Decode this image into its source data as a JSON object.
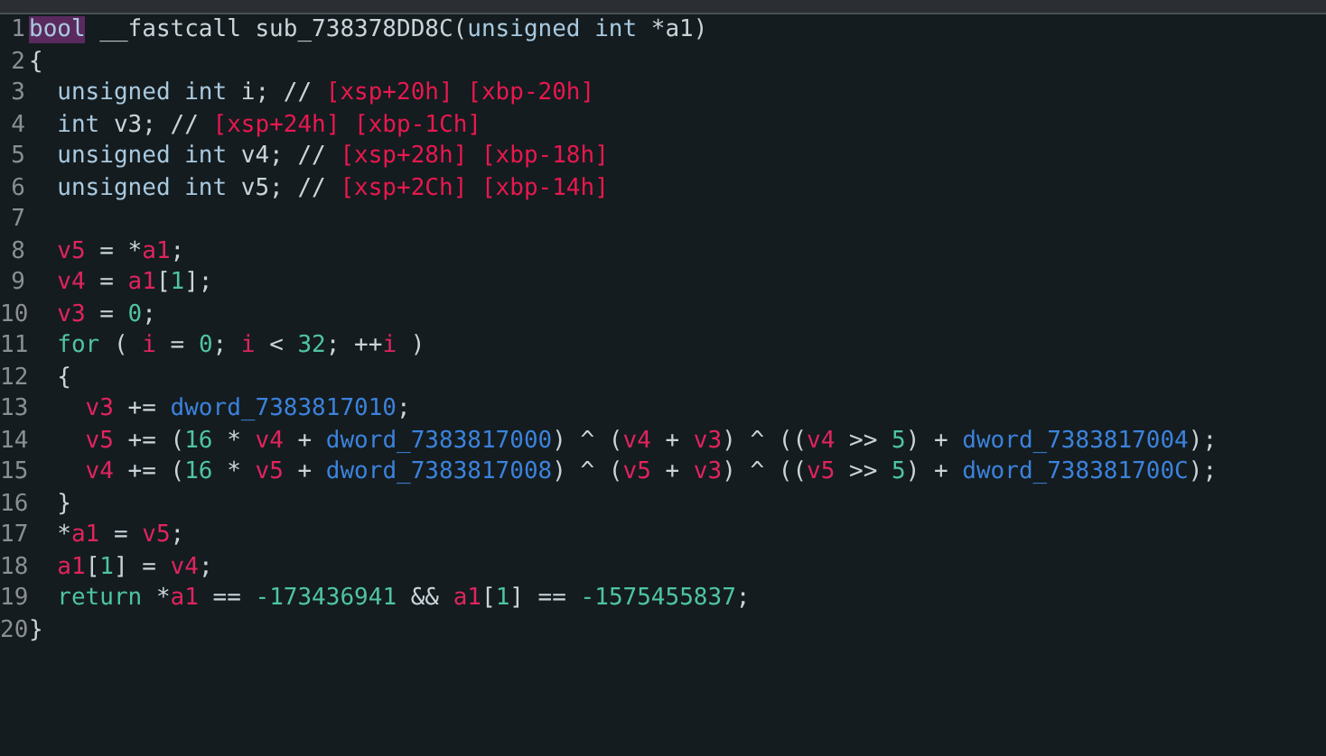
{
  "code_lines": [
    {
      "number": "1",
      "tokens": [
        {
          "text": "bool",
          "kind": "highlight"
        },
        {
          "text": " __fastcall sub_738378DD8C(",
          "kind": "plain"
        },
        {
          "text": "unsigned int",
          "kind": "type"
        },
        {
          "text": " *a1)",
          "kind": "plain"
        }
      ]
    },
    {
      "number": "2",
      "tokens": [
        {
          "text": "{",
          "kind": "plain"
        }
      ]
    },
    {
      "number": "3",
      "tokens": [
        {
          "text": "  unsigned int",
          "kind": "type"
        },
        {
          "text": " i; // ",
          "kind": "plain"
        },
        {
          "text": "[xsp+20h] [xbp-20h]",
          "kind": "comment"
        }
      ]
    },
    {
      "number": "4",
      "tokens": [
        {
          "text": "  int",
          "kind": "type"
        },
        {
          "text": " v3; // ",
          "kind": "plain"
        },
        {
          "text": "[xsp+24h] [xbp-1Ch]",
          "kind": "comment"
        }
      ]
    },
    {
      "number": "5",
      "tokens": [
        {
          "text": "  unsigned int",
          "kind": "type"
        },
        {
          "text": " v4; // ",
          "kind": "plain"
        },
        {
          "text": "[xsp+28h] [xbp-18h]",
          "kind": "comment"
        }
      ]
    },
    {
      "number": "6",
      "tokens": [
        {
          "text": "  unsigned int",
          "kind": "type"
        },
        {
          "text": " v5; // ",
          "kind": "plain"
        },
        {
          "text": "[xsp+2Ch] [xbp-14h]",
          "kind": "comment"
        }
      ]
    },
    {
      "number": "7"
    },
    {
      "number": "8",
      "tokens": [
        {
          "text": "  v5",
          "kind": "var"
        },
        {
          "text": " = *",
          "kind": "plain"
        },
        {
          "text": "a1",
          "kind": "var"
        },
        {
          "text": ";",
          "kind": "plain"
        }
      ]
    },
    {
      "number": "9",
      "tokens": [
        {
          "text": "  v4",
          "kind": "var"
        },
        {
          "text": " = ",
          "kind": "plain"
        },
        {
          "text": "a1",
          "kind": "var"
        },
        {
          "text": "[",
          "kind": "plain"
        },
        {
          "text": "1",
          "kind": "number"
        },
        {
          "text": "];",
          "kind": "plain"
        }
      ]
    },
    {
      "number": "10",
      "tokens": [
        {
          "text": "  v3",
          "kind": "var"
        },
        {
          "text": " = ",
          "kind": "plain"
        },
        {
          "text": "0",
          "kind": "number"
        },
        {
          "text": ";",
          "kind": "plain"
        }
      ]
    },
    {
      "number": "11",
      "tokens": [
        {
          "text": "  for",
          "kind": "keyword"
        },
        {
          "text": " ( ",
          "kind": "plain"
        },
        {
          "text": "i",
          "kind": "var"
        },
        {
          "text": " = ",
          "kind": "plain"
        },
        {
          "text": "0",
          "kind": "number"
        },
        {
          "text": "; ",
          "kind": "plain"
        },
        {
          "text": "i",
          "kind": "var"
        },
        {
          "text": " < ",
          "kind": "plain"
        },
        {
          "text": "32",
          "kind": "number"
        },
        {
          "text": "; ++",
          "kind": "plain"
        },
        {
          "text": "i",
          "kind": "var"
        },
        {
          "text": " )",
          "kind": "plain"
        }
      ]
    },
    {
      "number": "12",
      "tokens": [
        {
          "text": "  {",
          "kind": "plain"
        }
      ]
    },
    {
      "number": "13",
      "tokens": [
        {
          "text": "    v3",
          "kind": "var"
        },
        {
          "text": " += ",
          "kind": "plain"
        },
        {
          "text": "dword_7383817010",
          "kind": "global"
        },
        {
          "text": ";",
          "kind": "plain"
        }
      ]
    },
    {
      "number": "14",
      "tokens": [
        {
          "text": "    v5",
          "kind": "var"
        },
        {
          "text": " += (",
          "kind": "plain"
        },
        {
          "text": "16",
          "kind": "number"
        },
        {
          "text": " * ",
          "kind": "plain"
        },
        {
          "text": "v4",
          "kind": "var"
        },
        {
          "text": " + ",
          "kind": "plain"
        },
        {
          "text": "dword_7383817000",
          "kind": "global"
        },
        {
          "text": ") ^ (",
          "kind": "plain"
        },
        {
          "text": "v4",
          "kind": "var"
        },
        {
          "text": " + ",
          "kind": "plain"
        },
        {
          "text": "v3",
          "kind": "var"
        },
        {
          "text": ") ^ ((",
          "kind": "plain"
        },
        {
          "text": "v4",
          "kind": "var"
        },
        {
          "text": " >> ",
          "kind": "plain"
        },
        {
          "text": "5",
          "kind": "number"
        },
        {
          "text": ") + ",
          "kind": "plain"
        },
        {
          "text": "dword_7383817004",
          "kind": "global"
        },
        {
          "text": ");",
          "kind": "plain"
        }
      ]
    },
    {
      "number": "15",
      "tokens": [
        {
          "text": "    v4",
          "kind": "var"
        },
        {
          "text": " += (",
          "kind": "plain"
        },
        {
          "text": "16",
          "kind": "number"
        },
        {
          "text": " * ",
          "kind": "plain"
        },
        {
          "text": "v5",
          "kind": "var"
        },
        {
          "text": " + ",
          "kind": "plain"
        },
        {
          "text": "dword_7383817008",
          "kind": "global"
        },
        {
          "text": ") ^ (",
          "kind": "plain"
        },
        {
          "text": "v5",
          "kind": "var"
        },
        {
          "text": " + ",
          "kind": "plain"
        },
        {
          "text": "v3",
          "kind": "var"
        },
        {
          "text": ") ^ ((",
          "kind": "plain"
        },
        {
          "text": "v5",
          "kind": "var"
        },
        {
          "text": " >> ",
          "kind": "plain"
        },
        {
          "text": "5",
          "kind": "number"
        },
        {
          "text": ") + ",
          "kind": "plain"
        },
        {
          "text": "dword_738381700C",
          "kind": "global"
        },
        {
          "text": ");",
          "kind": "plain"
        }
      ]
    },
    {
      "number": "16",
      "tokens": [
        {
          "text": "  }",
          "kind": "plain"
        }
      ]
    },
    {
      "number": "17",
      "tokens": [
        {
          "text": "  *",
          "kind": "plain"
        },
        {
          "text": "a1",
          "kind": "var"
        },
        {
          "text": " = ",
          "kind": "plain"
        },
        {
          "text": "v5",
          "kind": "var"
        },
        {
          "text": ";",
          "kind": "plain"
        }
      ]
    },
    {
      "number": "18",
      "tokens": [
        {
          "text": "  a1",
          "kind": "var"
        },
        {
          "text": "[",
          "kind": "plain"
        },
        {
          "text": "1",
          "kind": "number"
        },
        {
          "text": "] = ",
          "kind": "plain"
        },
        {
          "text": "v4",
          "kind": "var"
        },
        {
          "text": ";",
          "kind": "plain"
        }
      ]
    },
    {
      "number": "19",
      "tokens": [
        {
          "text": "  return",
          "kind": "keyword"
        },
        {
          "text": " *",
          "kind": "plain"
        },
        {
          "text": "a1",
          "kind": "var"
        },
        {
          "text": " == ",
          "kind": "plain"
        },
        {
          "text": "-173436941",
          "kind": "number"
        },
        {
          "text": " && ",
          "kind": "plain"
        },
        {
          "text": "a1",
          "kind": "var"
        },
        {
          "text": "[",
          "kind": "plain"
        },
        {
          "text": "1",
          "kind": "number"
        },
        {
          "text": "] == ",
          "kind": "plain"
        },
        {
          "text": "-1575455837",
          "kind": "number"
        },
        {
          "text": ";",
          "kind": "plain"
        }
      ]
    },
    {
      "number": "20",
      "tokens": [
        {
          "text": "}",
          "kind": "plain"
        }
      ]
    }
  ]
}
